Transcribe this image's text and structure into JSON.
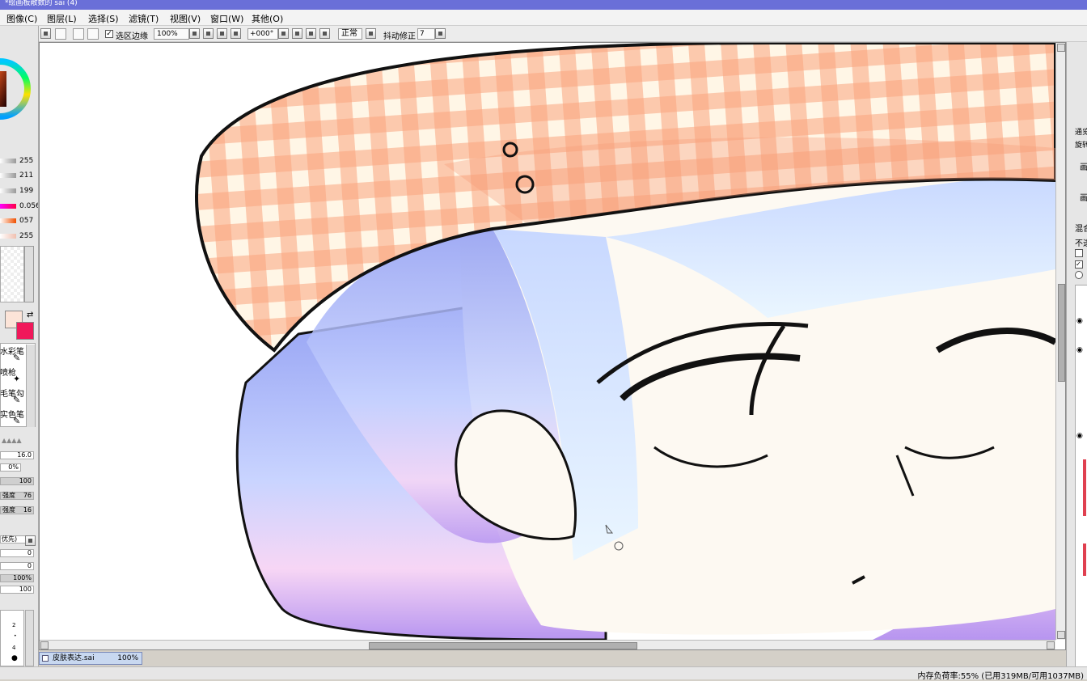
{
  "title": "*绘画板敞数的 sai (4)",
  "menu": [
    "图像(C)",
    "图层(L)",
    "选择(S)",
    "滤镜(T)",
    "视图(V)",
    "窗口(W)",
    "其他(O)"
  ],
  "toolbar": {
    "selection_edge_label": "选区边缘",
    "zoom_value": "100%",
    "rotation_value": "+000°",
    "blend_mode": "正常",
    "stabilizer_label": "抖动修正",
    "stabilizer_value": "7"
  },
  "left_panel": {
    "color_values": [
      "255",
      "211",
      "199",
      "0.056",
      "057",
      "255"
    ],
    "brushes": [
      "水彩笔",
      "喷枪",
      "毛笔勾",
      "实色笔"
    ],
    "size_value": "16.0",
    "min_size_value": "0%",
    "density_value": "100",
    "strength_label_1": "强度",
    "strength_value_1": "76",
    "strength_label_2": "强度",
    "strength_value_2": "16",
    "mode_label": "优先)",
    "param_values": [
      "0",
      "0",
      "100%",
      "100"
    ],
    "size_dots": [
      "2",
      "4"
    ]
  },
  "right_panel": {
    "labels": [
      "通览",
      "旋转",
      "画",
      "画",
      "混合",
      "不透"
    ]
  },
  "document_tab": {
    "name": "皮肤表达.sai",
    "zoom": "100%"
  },
  "status": "内存负荷率:55% (已用319MB/可用1037MB)",
  "colors": {
    "primary_color": "#fce4d8",
    "secondary_color": "#f0185a",
    "menu_accent": "#6a6fd8"
  },
  "scroll": {
    "vertical_thumb_start": 0.4,
    "vertical_thumb_length": 0.17,
    "horizontal_thumb_start": 0.32,
    "horizontal_thumb_length": 0.27
  }
}
